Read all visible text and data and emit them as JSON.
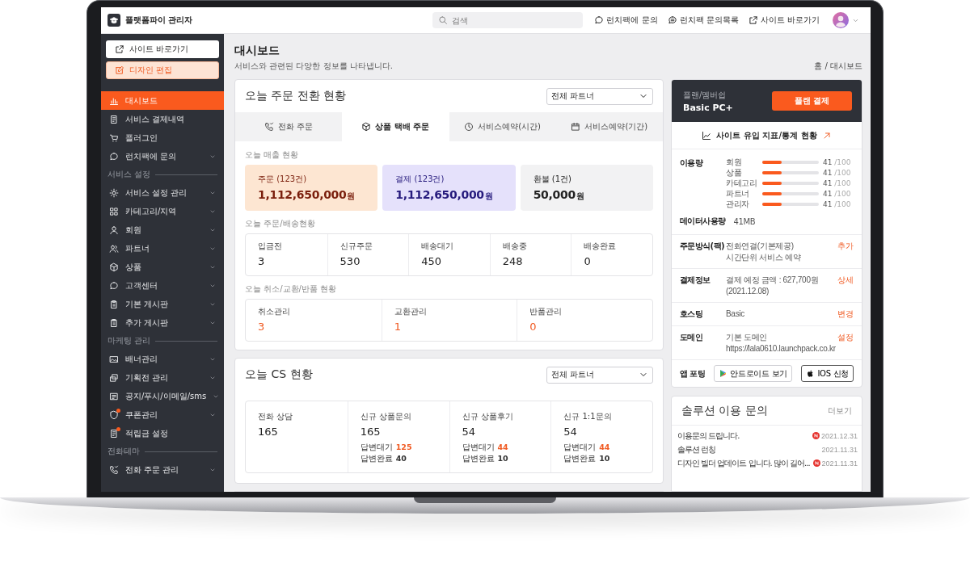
{
  "app": {
    "title": "플랫폼파이 관리자"
  },
  "topbar": {
    "search_placeholder": "검색",
    "links": [
      "런치팩에 문의",
      "런치팩 문의목록",
      "사이트 바로가기"
    ]
  },
  "sidebar": {
    "buttons": [
      {
        "label": "사이트 바로가기",
        "kind": "plain"
      },
      {
        "label": "디자인 편집",
        "kind": "accent"
      }
    ],
    "sections": [
      {
        "items": [
          {
            "label": "대시보드",
            "selected": true,
            "expandable": false,
            "dot": false
          },
          {
            "label": "서비스 결제내역",
            "selected": false,
            "expandable": false,
            "dot": false
          },
          {
            "label": "플러그인",
            "selected": false,
            "expandable": false,
            "dot": false
          },
          {
            "label": "런치팩에 문의",
            "selected": false,
            "expandable": true,
            "dot": false
          }
        ]
      },
      {
        "title": "서비스 설정",
        "items": [
          {
            "label": "서비스 설정 관리",
            "selected": false,
            "expandable": true,
            "dot": false
          },
          {
            "label": "카테고리/지역",
            "selected": false,
            "expandable": true,
            "dot": false
          },
          {
            "label": "회원",
            "selected": false,
            "expandable": true,
            "dot": false
          },
          {
            "label": "파트너",
            "selected": false,
            "expandable": true,
            "dot": false
          },
          {
            "label": "상품",
            "selected": false,
            "expandable": true,
            "dot": false
          },
          {
            "label": "고객센터",
            "selected": false,
            "expandable": true,
            "dot": false
          },
          {
            "label": "기본 게시판",
            "selected": false,
            "expandable": true,
            "dot": false
          },
          {
            "label": "추가 게시판",
            "selected": false,
            "expandable": true,
            "dot": false
          }
        ]
      },
      {
        "title": "마케팅 관리",
        "items": [
          {
            "label": "배너관리",
            "selected": false,
            "expandable": true,
            "dot": false
          },
          {
            "label": "기획전 관리",
            "selected": false,
            "expandable": true,
            "dot": false
          },
          {
            "label": "공지/푸시/이메일/sms",
            "selected": false,
            "expandable": true,
            "dot": false
          },
          {
            "label": "쿠폰관리",
            "selected": false,
            "expandable": true,
            "dot": true
          },
          {
            "label": "적립금 설정",
            "selected": false,
            "expandable": false,
            "dot": true
          }
        ]
      },
      {
        "title": "전화테마",
        "items": [
          {
            "label": "전화 주문 관리",
            "selected": false,
            "expandable": true,
            "dot": false
          }
        ]
      }
    ]
  },
  "page": {
    "title": "대시보드",
    "subtitle": "서비스와 관련된 다양한 정보를 나타냅니다.",
    "breadcrumb": "홈 / 대시보드"
  },
  "order_card": {
    "title": "오늘 주문 전환 현황",
    "filter": "전체 파트너",
    "tabs": [
      {
        "label": "전화 주문",
        "selected": false
      },
      {
        "label": "상품 택배 주문",
        "selected": true
      },
      {
        "label": "서비스예약(시간)",
        "selected": false
      },
      {
        "label": "서비스예약(기간)",
        "selected": false
      }
    ],
    "sales_label": "오늘 매출 현황",
    "sales": [
      {
        "label": "주문 (123건)",
        "amount": "1,112,650,000",
        "unit": "원",
        "kind": "order"
      },
      {
        "label": "결제 (123건)",
        "amount": "1,112,650,000",
        "unit": "원",
        "kind": "payment"
      },
      {
        "label": "환불 (1건)",
        "amount": "50,000",
        "unit": "원",
        "kind": "refund"
      }
    ],
    "shipping_label": "오늘 주문/배송현황",
    "shipping": [
      {
        "label": "입금전",
        "value": "3"
      },
      {
        "label": "신규주문",
        "value": "530"
      },
      {
        "label": "배송대기",
        "value": "450"
      },
      {
        "label": "배송중",
        "value": "248"
      },
      {
        "label": "배송완료",
        "value": "0"
      }
    ],
    "returns_label": "오늘 취소/교환/반품 현황",
    "returns": [
      {
        "label": "취소관리",
        "value": "3"
      },
      {
        "label": "교환관리",
        "value": "1"
      },
      {
        "label": "반품관리",
        "value": "0"
      }
    ]
  },
  "cs_card": {
    "title": "오늘 CS 현황",
    "filter": "전체 파트너",
    "stats": [
      {
        "label": "전화 상담",
        "value": "165"
      },
      {
        "label": "신규 상품문의",
        "value": "165",
        "pending_label": "답변대기",
        "pending": "125",
        "done_label": "답변완료",
        "done": "40"
      },
      {
        "label": "신규 상품후기",
        "value": "54",
        "pending_label": "답변대기",
        "pending": "44",
        "done_label": "답변완료",
        "done": "10"
      },
      {
        "label": "신규 1:1문의",
        "value": "54",
        "pending_label": "답변대기",
        "pending": "44",
        "done_label": "답변완료",
        "done": "10"
      }
    ]
  },
  "plan": {
    "label": "플랜/멤버쉽",
    "name": "Basic PC+",
    "button": "플랜 결제",
    "stats_link": "사이트 유입 지표/통계 현황",
    "usage_label": "이용량",
    "usage": [
      {
        "name": "회원",
        "level": 0.34,
        "value": "41",
        "max": "/100"
      },
      {
        "name": "상품",
        "level": 0.34,
        "value": "41",
        "max": "/100"
      },
      {
        "name": "카테고리",
        "level": 0.34,
        "value": "41",
        "max": "/100"
      },
      {
        "name": "파트너",
        "level": 0.34,
        "value": "41",
        "max": "/100"
      },
      {
        "name": "관리자",
        "level": 0.34,
        "value": "41",
        "max": "/100"
      }
    ],
    "data_label": "데이터사용량",
    "data_value": "41MB",
    "rows": [
      {
        "label": "주문방식(팩)",
        "lines": [
          "전화연결(기본제공)",
          "시간단위 서비스 예약"
        ],
        "action": "추가"
      },
      {
        "label": "결제정보",
        "lines": [
          "결제 예정 금액 : 627,700원",
          "(2021.12.08)"
        ],
        "action": "상세"
      },
      {
        "label": "호스팅",
        "lines": [
          "Basic"
        ],
        "action": "변경"
      },
      {
        "label": "도메인",
        "lines": [
          "기본 도메인",
          "https://lala0610.launchpack.co.kr"
        ],
        "action": "설정"
      }
    ],
    "app_label": "앱 포팅",
    "app_buttons": [
      "안드로이드 보기",
      "IOS 신청"
    ]
  },
  "inquiries": {
    "title": "솔루션 이용 문의",
    "more": "더보기",
    "items": [
      {
        "title": "이용문의 드립니다.",
        "date": "2021.12.31",
        "new": true
      },
      {
        "title": "솔루션 런칭",
        "date": "2021.11.31",
        "new": false
      },
      {
        "title": "디자인 빌더 업데이트 입니다. 많이 길어...",
        "date": "2021.11.31",
        "new": true
      }
    ]
  }
}
